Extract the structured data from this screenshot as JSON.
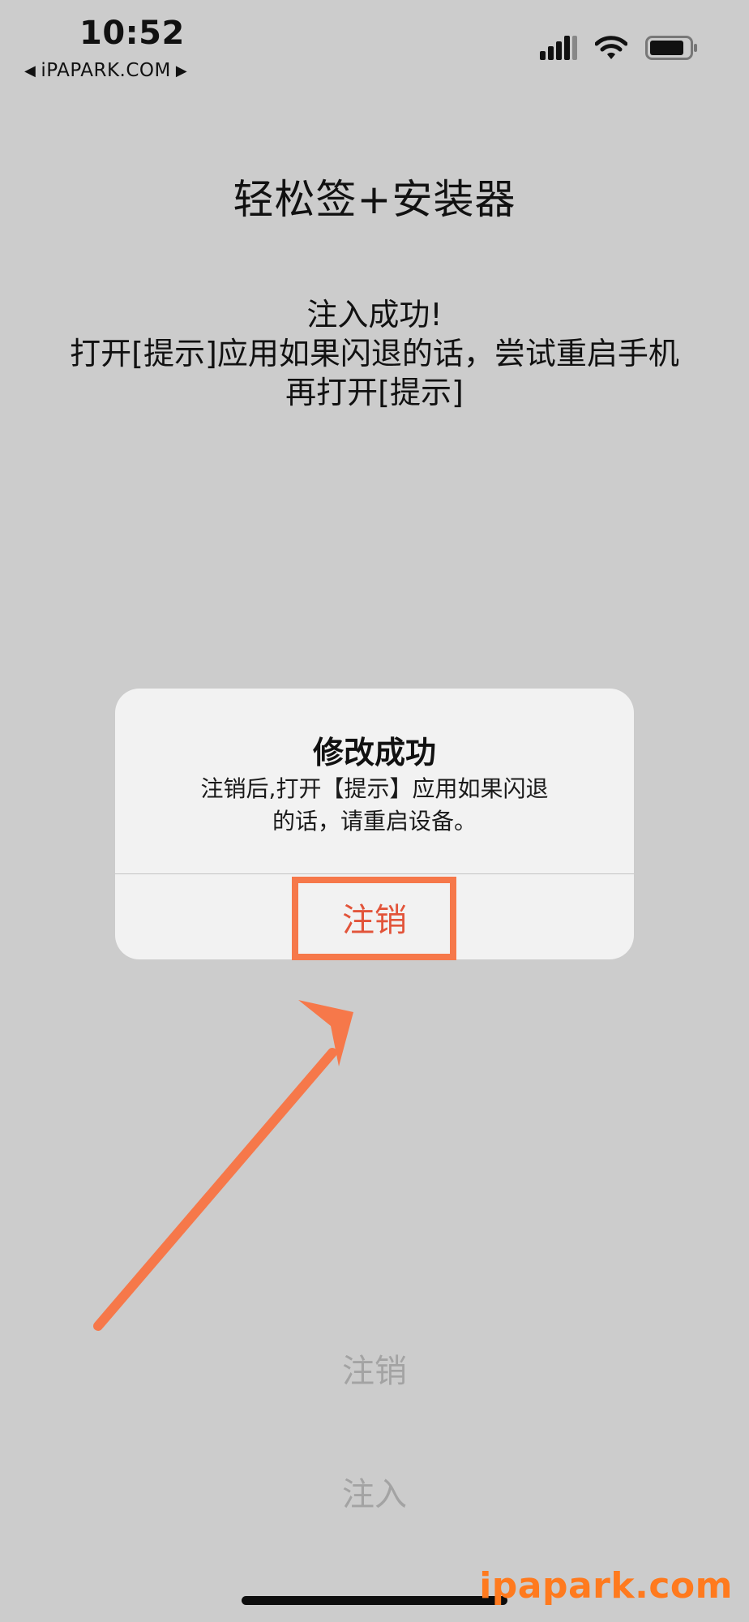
{
  "status_bar": {
    "time": "10:52",
    "back_label": "iPAPARK.COM",
    "back_left_icon": "triangle-left-icon",
    "back_right_icon": "triangle-right-icon",
    "icons": [
      "cellular-signal-icon",
      "wifi-icon",
      "battery-icon"
    ]
  },
  "app": {
    "title": "轻松签+安装器",
    "message_lines": [
      "注入成功!",
      "打开[提示]应用如果闪退的话，尝试重启手机",
      "再打开[提示]"
    ],
    "buttons": {
      "logout": "注销",
      "inject": "注入"
    }
  },
  "alert": {
    "title": "修改成功",
    "message_lines": [
      "注销后,打开【提示】应用如果闪退",
      "的话，请重启设备。"
    ],
    "action_label": "注销"
  },
  "annotation": {
    "color": "#f6784a",
    "highlight_target": "alert-action-button",
    "arrow_icon": "pointer-arrow-icon"
  },
  "watermark": "ipapark.com",
  "colors": {
    "background": "#cccccc",
    "dialog": "#f2f2f2",
    "action": "#e2543a",
    "disabled_text": "#a3a3a3",
    "watermark": "#ff7a1e"
  }
}
